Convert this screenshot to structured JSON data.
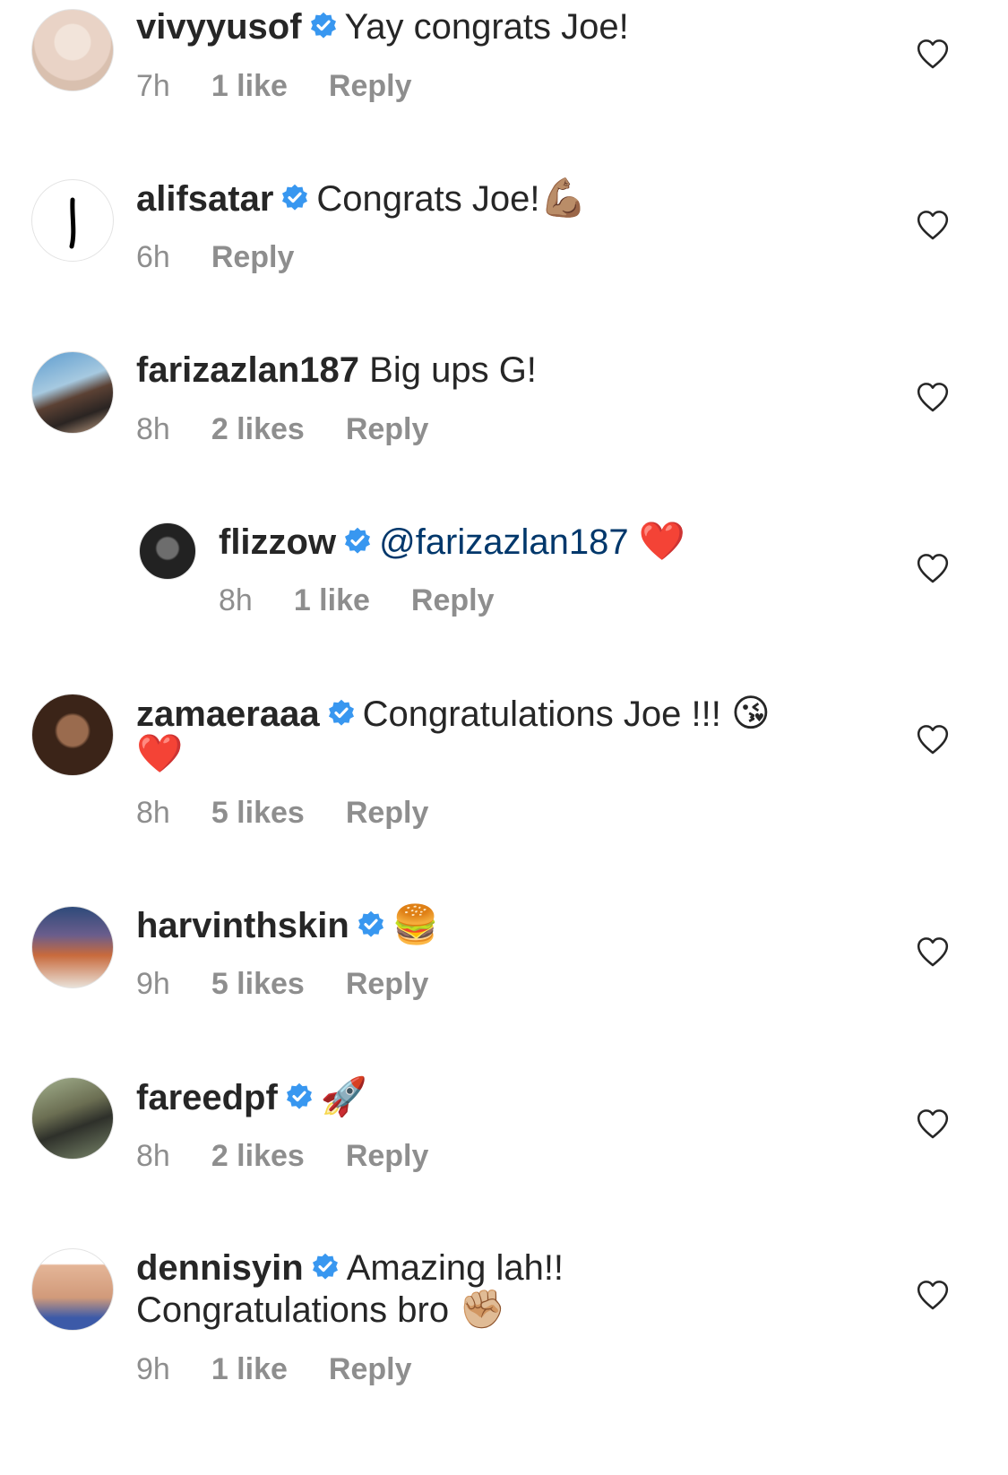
{
  "comments": [
    {
      "username": "vivyyusof",
      "verified": true,
      "text": "Yay congrats Joe!",
      "time": "7h",
      "likes": "1 like",
      "reply": "Reply"
    },
    {
      "username": "alifsatar",
      "verified": true,
      "text": "Congrats Joe!",
      "emoji": "💪🏽",
      "time": "6h",
      "likes": "",
      "reply": "Reply"
    },
    {
      "username": "farizazlan187",
      "verified": false,
      "text": "Big ups G!",
      "time": "8h",
      "likes": "2 likes",
      "reply": "Reply"
    },
    {
      "username": "flizzow",
      "verified": true,
      "mention": "@farizazlan187",
      "emoji": "❤️",
      "time": "8h",
      "likes": "1 like",
      "reply": "Reply",
      "is_reply": true
    },
    {
      "username": "zamaeraaa",
      "verified": true,
      "text": "Congratulations Joe !!!",
      "emoji": "😘",
      "emoji_line2": "❤️",
      "time": "8h",
      "likes": "5 likes",
      "reply": "Reply"
    },
    {
      "username": "harvinthskin",
      "verified": true,
      "emoji": "🍔",
      "time": "9h",
      "likes": "5 likes",
      "reply": "Reply"
    },
    {
      "username": "fareedpf",
      "verified": true,
      "emoji": "🚀",
      "time": "8h",
      "likes": "2 likes",
      "reply": "Reply"
    },
    {
      "username": "dennisyin",
      "verified": true,
      "text": "Amazing lah!!",
      "text_line2": "Congratulations bro",
      "emoji": "✊🏼",
      "time": "9h",
      "likes": "1 like",
      "reply": "Reply"
    }
  ],
  "colors": {
    "verified": "#3897f0",
    "mention": "#00376b",
    "meta": "#8e8e8e",
    "text": "#262626"
  },
  "icons": {
    "verified": "verified-badge-icon",
    "like": "heart-outline-icon"
  }
}
